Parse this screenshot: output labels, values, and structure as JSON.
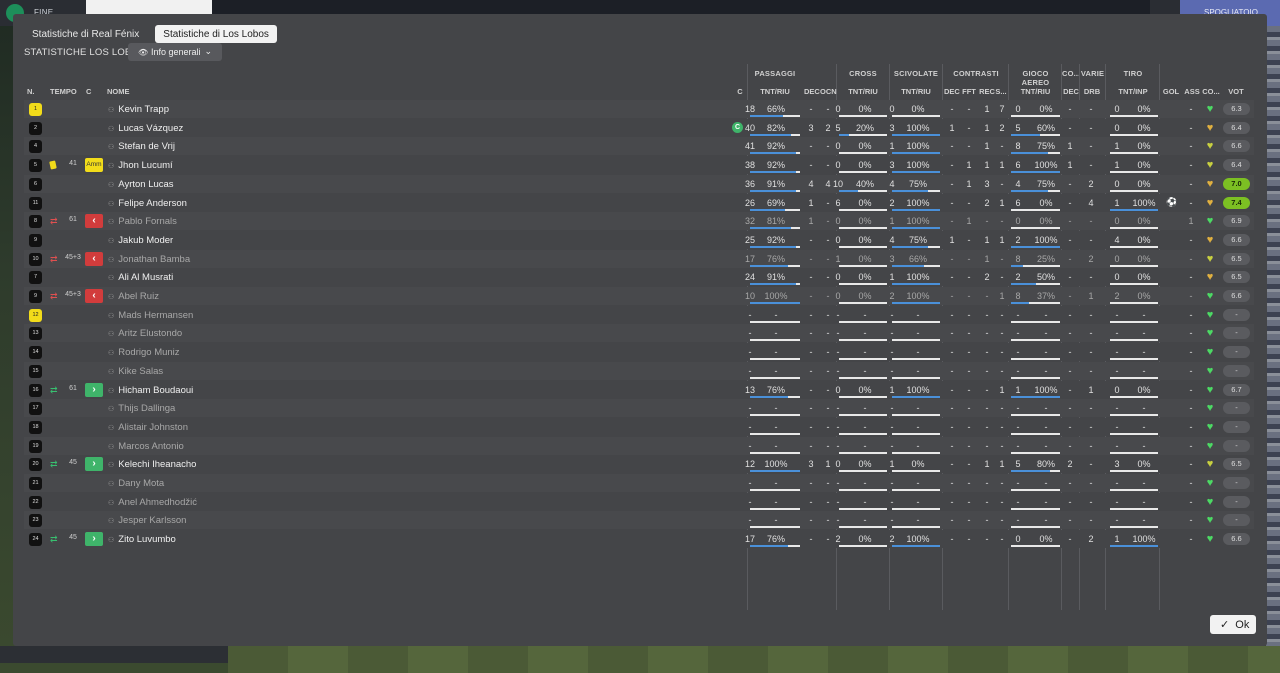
{
  "topbar": {
    "left_label": "FINE PARTITA",
    "right_label": "SPOGLIATOIO"
  },
  "tabs": [
    "Statistiche di Real Fénix",
    "Statistiche di Los Lobos"
  ],
  "subheader": "STATISTICHE LOS LOBOS",
  "dropdown": "Info generali",
  "ok_label": "Ok",
  "groups": [
    "PASSAGGI",
    "CROSS",
    "SCIVOLATE",
    "CONTRASTI",
    "GIOCO AEREO",
    "CO...",
    "VARIE",
    "TIRO"
  ],
  "columns": {
    "n": "N.",
    "tempo": "TEMPO",
    "c": "C",
    "nome": "NOME",
    "cap": "C",
    "pass_tnt": "TNT/RIU",
    "pass_dec": "DEC",
    "pass_ocn": "OCN",
    "cross_tnt": "TNT/RIU",
    "sciv_tnt": "TNT/RIU",
    "con_dec": "DEC",
    "con_fft": "FFT",
    "con_rec": "REC",
    "con_s": "S...",
    "aereo_tnt": "TNT/RIU",
    "co_dec": "DEC",
    "varie_drb": "DRB",
    "tiro_tnt": "TNT/INP",
    "gol": "GOL",
    "ass": "ASS",
    "co": "CO...",
    "vot": "VOT"
  },
  "players": [
    {
      "num": "1",
      "gk": true,
      "ev": "",
      "time": "",
      "badge": "",
      "name": "Kevin Trapp",
      "dim": false,
      "cap": false,
      "p": [
        "18",
        "66%"
      ],
      "pdec": "-",
      "pocn": "-",
      "cr": [
        "0",
        "0%"
      ],
      "sc": [
        "0",
        "0%"
      ],
      "con": [
        "-",
        "-",
        "1",
        "7"
      ],
      "ae": [
        "0",
        "0%"
      ],
      "codec": "-",
      "drb": "-",
      "ti": [
        "0",
        "0%"
      ],
      "gol": "",
      "ass": "-",
      "hc": "#4cd964",
      "vot": "6.3",
      "vg": false,
      "pf": 0.66,
      "crf": 0,
      "scf": 0,
      "aef": 0,
      "tif": 0
    },
    {
      "num": "2",
      "gk": false,
      "ev": "",
      "time": "",
      "badge": "",
      "name": "Lucas Vázquez",
      "dim": false,
      "cap": true,
      "p": [
        "40",
        "82%"
      ],
      "pdec": "3",
      "pocn": "2",
      "cr": [
        "5",
        "20%"
      ],
      "sc": [
        "3",
        "100%"
      ],
      "con": [
        "1",
        "-",
        "1",
        "2"
      ],
      "ae": [
        "5",
        "60%"
      ],
      "codec": "-",
      "drb": "-",
      "ti": [
        "0",
        "0%"
      ],
      "gol": "",
      "ass": "-",
      "hc": "#e0b040",
      "vot": "6.4",
      "vg": false,
      "pf": 0.82,
      "crf": 0.2,
      "scf": 1,
      "aef": 0.6,
      "tif": 0
    },
    {
      "num": "4",
      "gk": false,
      "ev": "",
      "time": "",
      "badge": "",
      "name": "Stefan de Vrij",
      "dim": false,
      "cap": false,
      "p": [
        "41",
        "92%"
      ],
      "pdec": "-",
      "pocn": "-",
      "cr": [
        "0",
        "0%"
      ],
      "sc": [
        "1",
        "100%"
      ],
      "con": [
        "-",
        "-",
        "1",
        "-"
      ],
      "ae": [
        "8",
        "75%"
      ],
      "codec": "1",
      "drb": "-",
      "ti": [
        "1",
        "0%"
      ],
      "gol": "",
      "ass": "-",
      "hc": "#c8d040",
      "vot": "6.6",
      "vg": false,
      "pf": 0.92,
      "crf": 0,
      "scf": 1,
      "aef": 0.75,
      "tif": 0
    },
    {
      "num": "5",
      "gk": false,
      "ev": "ycard",
      "time": "41",
      "badge": "Amm",
      "name": "Jhon Lucumí",
      "dim": false,
      "cap": false,
      "p": [
        "38",
        "92%"
      ],
      "pdec": "-",
      "pocn": "-",
      "cr": [
        "0",
        "0%"
      ],
      "sc": [
        "3",
        "100%"
      ],
      "con": [
        "-",
        "1",
        "1",
        "1"
      ],
      "ae": [
        "6",
        "100%"
      ],
      "codec": "1",
      "drb": "-",
      "ti": [
        "1",
        "0%"
      ],
      "gol": "",
      "ass": "-",
      "hc": "#c8d040",
      "vot": "6.4",
      "vg": false,
      "pf": 0.92,
      "crf": 0,
      "scf": 1,
      "aef": 1,
      "tif": 0
    },
    {
      "num": "6",
      "gk": false,
      "ev": "",
      "time": "",
      "badge": "",
      "name": "Ayrton Lucas",
      "dim": false,
      "cap": false,
      "p": [
        "36",
        "91%"
      ],
      "pdec": "4",
      "pocn": "4",
      "cr": [
        "10",
        "40%"
      ],
      "sc": [
        "4",
        "75%"
      ],
      "con": [
        "-",
        "1",
        "3",
        "-"
      ],
      "ae": [
        "4",
        "75%"
      ],
      "codec": "-",
      "drb": "2",
      "ti": [
        "0",
        "0%"
      ],
      "gol": "",
      "ass": "-",
      "hc": "#e0b040",
      "vot": "7.0",
      "vg": true,
      "pf": 0.91,
      "crf": 0.4,
      "scf": 0.75,
      "aef": 0.75,
      "tif": 0
    },
    {
      "num": "11",
      "gk": false,
      "ev": "",
      "time": "",
      "badge": "",
      "name": "Felipe Anderson",
      "dim": false,
      "cap": false,
      "p": [
        "26",
        "69%"
      ],
      "pdec": "1",
      "pocn": "-",
      "cr": [
        "6",
        "0%"
      ],
      "sc": [
        "2",
        "100%"
      ],
      "con": [
        "-",
        "-",
        "2",
        "1"
      ],
      "ae": [
        "6",
        "0%"
      ],
      "codec": "-",
      "drb": "4",
      "ti": [
        "1",
        "100%"
      ],
      "gol": "⚽",
      "ass": "-",
      "hc": "#e0b040",
      "vot": "7.4",
      "vg": true,
      "pf": 0.69,
      "crf": 0,
      "scf": 1,
      "aef": 0,
      "tif": 1
    },
    {
      "num": "8",
      "gk": false,
      "ev": "out",
      "time": "61",
      "badge": "out",
      "name": "Pablo Fornals",
      "dim": true,
      "cap": false,
      "p": [
        "32",
        "81%"
      ],
      "pdec": "1",
      "pocn": "-",
      "cr": [
        "0",
        "0%"
      ],
      "sc": [
        "1",
        "100%"
      ],
      "con": [
        "-",
        "1",
        "-",
        "-"
      ],
      "ae": [
        "0",
        "0%"
      ],
      "codec": "-",
      "drb": "-",
      "ti": [
        "0",
        "0%"
      ],
      "gol": "",
      "ass": "1",
      "hc": "#4cd964",
      "vot": "6.9",
      "vg": false,
      "pf": 0.81,
      "crf": 0,
      "scf": 1,
      "aef": 0,
      "tif": 0
    },
    {
      "num": "9",
      "gk": false,
      "ev": "",
      "time": "",
      "badge": "",
      "name": "Jakub Moder",
      "dim": false,
      "cap": false,
      "p": [
        "25",
        "92%"
      ],
      "pdec": "-",
      "pocn": "-",
      "cr": [
        "0",
        "0%"
      ],
      "sc": [
        "4",
        "75%"
      ],
      "con": [
        "1",
        "-",
        "1",
        "1"
      ],
      "ae": [
        "2",
        "100%"
      ],
      "codec": "-",
      "drb": "-",
      "ti": [
        "4",
        "0%"
      ],
      "gol": "",
      "ass": "-",
      "hc": "#e0b040",
      "vot": "6.6",
      "vg": false,
      "pf": 0.92,
      "crf": 0,
      "scf": 0.75,
      "aef": 1,
      "tif": 0
    },
    {
      "num": "10",
      "gk": false,
      "ev": "out",
      "time": "45+3",
      "badge": "out",
      "name": "Jonathan Bamba",
      "dim": true,
      "cap": false,
      "p": [
        "17",
        "76%"
      ],
      "pdec": "-",
      "pocn": "-",
      "cr": [
        "1",
        "0%"
      ],
      "sc": [
        "3",
        "66%"
      ],
      "con": [
        "-",
        "-",
        "1",
        "-"
      ],
      "ae": [
        "8",
        "25%"
      ],
      "codec": "-",
      "drb": "2",
      "ti": [
        "0",
        "0%"
      ],
      "gol": "",
      "ass": "-",
      "hc": "#c8d040",
      "vot": "6.5",
      "vg": false,
      "pf": 0.76,
      "crf": 0,
      "scf": 0.66,
      "aef": 0.25,
      "tif": 0
    },
    {
      "num": "7",
      "gk": false,
      "ev": "",
      "time": "",
      "badge": "",
      "name": "Ali Al Musrati",
      "dim": false,
      "cap": false,
      "p": [
        "24",
        "91%"
      ],
      "pdec": "-",
      "pocn": "-",
      "cr": [
        "0",
        "0%"
      ],
      "sc": [
        "1",
        "100%"
      ],
      "con": [
        "-",
        "-",
        "2",
        "-"
      ],
      "ae": [
        "2",
        "50%"
      ],
      "codec": "-",
      "drb": "-",
      "ti": [
        "0",
        "0%"
      ],
      "gol": "",
      "ass": "-",
      "hc": "#e0b040",
      "vot": "6.5",
      "vg": false,
      "pf": 0.91,
      "crf": 0,
      "scf": 1,
      "aef": 0.5,
      "tif": 0
    },
    {
      "num": "9",
      "gk": false,
      "ev": "out",
      "time": "45+3",
      "badge": "out",
      "name": "Abel Ruiz",
      "dim": true,
      "cap": false,
      "p": [
        "10",
        "100%"
      ],
      "pdec": "-",
      "pocn": "-",
      "cr": [
        "0",
        "0%"
      ],
      "sc": [
        "2",
        "100%"
      ],
      "con": [
        "-",
        "-",
        "-",
        "1"
      ],
      "ae": [
        "8",
        "37%"
      ],
      "codec": "-",
      "drb": "1",
      "ti": [
        "2",
        "0%"
      ],
      "gol": "",
      "ass": "-",
      "hc": "#4cd964",
      "vot": "6.6",
      "vg": false,
      "pf": 1,
      "crf": 0,
      "scf": 1,
      "aef": 0.37,
      "tif": 0
    },
    {
      "num": "12",
      "gk": true,
      "ev": "",
      "time": "",
      "badge": "",
      "name": "Mads Hermansen",
      "dim": true,
      "cap": false,
      "p": [
        "-",
        "-"
      ],
      "pdec": "-",
      "pocn": "-",
      "cr": [
        "-",
        "-"
      ],
      "sc": [
        "-",
        "-"
      ],
      "con": [
        "-",
        "-",
        "-",
        "-"
      ],
      "ae": [
        "-",
        "-"
      ],
      "codec": "-",
      "drb": "-",
      "ti": [
        "-",
        "-"
      ],
      "gol": "",
      "ass": "-",
      "hc": "#4cd964",
      "vot": "-",
      "vg": false,
      "pf": 0,
      "crf": 0,
      "scf": 0,
      "aef": 0,
      "tif": 0
    },
    {
      "num": "13",
      "gk": false,
      "ev": "",
      "time": "",
      "badge": "",
      "name": "Aritz Elustondo",
      "dim": true,
      "cap": false,
      "p": [
        "-",
        "-"
      ],
      "pdec": "-",
      "pocn": "-",
      "cr": [
        "-",
        "-"
      ],
      "sc": [
        "-",
        "-"
      ],
      "con": [
        "-",
        "-",
        "-",
        "-"
      ],
      "ae": [
        "-",
        "-"
      ],
      "codec": "-",
      "drb": "-",
      "ti": [
        "-",
        "-"
      ],
      "gol": "",
      "ass": "-",
      "hc": "#4cd964",
      "vot": "-",
      "vg": false,
      "pf": 0,
      "crf": 0,
      "scf": 0,
      "aef": 0,
      "tif": 0
    },
    {
      "num": "14",
      "gk": false,
      "ev": "",
      "time": "",
      "badge": "",
      "name": "Rodrigo Muniz",
      "dim": true,
      "cap": false,
      "p": [
        "-",
        "-"
      ],
      "pdec": "-",
      "pocn": "-",
      "cr": [
        "-",
        "-"
      ],
      "sc": [
        "-",
        "-"
      ],
      "con": [
        "-",
        "-",
        "-",
        "-"
      ],
      "ae": [
        "-",
        "-"
      ],
      "codec": "-",
      "drb": "-",
      "ti": [
        "-",
        "-"
      ],
      "gol": "",
      "ass": "-",
      "hc": "#4cd964",
      "vot": "-",
      "vg": false,
      "pf": 0,
      "crf": 0,
      "scf": 0,
      "aef": 0,
      "tif": 0
    },
    {
      "num": "15",
      "gk": false,
      "ev": "",
      "time": "",
      "badge": "",
      "name": "Kike Salas",
      "dim": true,
      "cap": false,
      "p": [
        "-",
        "-"
      ],
      "pdec": "-",
      "pocn": "-",
      "cr": [
        "-",
        "-"
      ],
      "sc": [
        "-",
        "-"
      ],
      "con": [
        "-",
        "-",
        "-",
        "-"
      ],
      "ae": [
        "-",
        "-"
      ],
      "codec": "-",
      "drb": "-",
      "ti": [
        "-",
        "-"
      ],
      "gol": "",
      "ass": "-",
      "hc": "#4cd964",
      "vot": "-",
      "vg": false,
      "pf": 0,
      "crf": 0,
      "scf": 0,
      "aef": 0,
      "tif": 0
    },
    {
      "num": "16",
      "gk": false,
      "ev": "in",
      "time": "61",
      "badge": "in",
      "name": "Hicham Boudaoui",
      "dim": false,
      "cap": false,
      "p": [
        "13",
        "76%"
      ],
      "pdec": "-",
      "pocn": "-",
      "cr": [
        "0",
        "0%"
      ],
      "sc": [
        "1",
        "100%"
      ],
      "con": [
        "-",
        "-",
        "-",
        "1"
      ],
      "ae": [
        "1",
        "100%"
      ],
      "codec": "-",
      "drb": "1",
      "ti": [
        "0",
        "0%"
      ],
      "gol": "",
      "ass": "-",
      "hc": "#4cd964",
      "vot": "6.7",
      "vg": false,
      "pf": 0.76,
      "crf": 0,
      "scf": 1,
      "aef": 1,
      "tif": 0
    },
    {
      "num": "17",
      "gk": false,
      "ev": "",
      "time": "",
      "badge": "",
      "name": "Thijs Dallinga",
      "dim": true,
      "cap": false,
      "p": [
        "-",
        "-"
      ],
      "pdec": "-",
      "pocn": "-",
      "cr": [
        "-",
        "-"
      ],
      "sc": [
        "-",
        "-"
      ],
      "con": [
        "-",
        "-",
        "-",
        "-"
      ],
      "ae": [
        "-",
        "-"
      ],
      "codec": "-",
      "drb": "-",
      "ti": [
        "-",
        "-"
      ],
      "gol": "",
      "ass": "-",
      "hc": "#4cd964",
      "vot": "-",
      "vg": false,
      "pf": 0,
      "crf": 0,
      "scf": 0,
      "aef": 0,
      "tif": 0
    },
    {
      "num": "18",
      "gk": false,
      "ev": "",
      "time": "",
      "badge": "",
      "name": "Alistair Johnston",
      "dim": true,
      "cap": false,
      "p": [
        "-",
        "-"
      ],
      "pdec": "-",
      "pocn": "-",
      "cr": [
        "-",
        "-"
      ],
      "sc": [
        "-",
        "-"
      ],
      "con": [
        "-",
        "-",
        "-",
        "-"
      ],
      "ae": [
        "-",
        "-"
      ],
      "codec": "-",
      "drb": "-",
      "ti": [
        "-",
        "-"
      ],
      "gol": "",
      "ass": "-",
      "hc": "#4cd964",
      "vot": "-",
      "vg": false,
      "pf": 0,
      "crf": 0,
      "scf": 0,
      "aef": 0,
      "tif": 0
    },
    {
      "num": "19",
      "gk": false,
      "ev": "",
      "time": "",
      "badge": "",
      "name": "Marcos Antonio",
      "dim": true,
      "cap": false,
      "p": [
        "-",
        "-"
      ],
      "pdec": "-",
      "pocn": "-",
      "cr": [
        "-",
        "-"
      ],
      "sc": [
        "-",
        "-"
      ],
      "con": [
        "-",
        "-",
        "-",
        "-"
      ],
      "ae": [
        "-",
        "-"
      ],
      "codec": "-",
      "drb": "-",
      "ti": [
        "-",
        "-"
      ],
      "gol": "",
      "ass": "-",
      "hc": "#4cd964",
      "vot": "-",
      "vg": false,
      "pf": 0,
      "crf": 0,
      "scf": 0,
      "aef": 0,
      "tif": 0
    },
    {
      "num": "20",
      "gk": false,
      "ev": "in",
      "time": "45",
      "badge": "in",
      "name": "Kelechi Iheanacho",
      "dim": false,
      "cap": false,
      "p": [
        "12",
        "100%"
      ],
      "pdec": "3",
      "pocn": "1",
      "cr": [
        "0",
        "0%"
      ],
      "sc": [
        "1",
        "0%"
      ],
      "con": [
        "-",
        "-",
        "1",
        "1"
      ],
      "ae": [
        "5",
        "80%"
      ],
      "codec": "2",
      "drb": "-",
      "ti": [
        "3",
        "0%"
      ],
      "gol": "",
      "ass": "-",
      "hc": "#c8d040",
      "vot": "6.5",
      "vg": false,
      "pf": 1,
      "crf": 0,
      "scf": 0,
      "aef": 0.8,
      "tif": 0
    },
    {
      "num": "21",
      "gk": false,
      "ev": "",
      "time": "",
      "badge": "",
      "name": "Dany Mota",
      "dim": true,
      "cap": false,
      "p": [
        "-",
        "-"
      ],
      "pdec": "-",
      "pocn": "-",
      "cr": [
        "-",
        "-"
      ],
      "sc": [
        "-",
        "-"
      ],
      "con": [
        "-",
        "-",
        "-",
        "-"
      ],
      "ae": [
        "-",
        "-"
      ],
      "codec": "-",
      "drb": "-",
      "ti": [
        "-",
        "-"
      ],
      "gol": "",
      "ass": "-",
      "hc": "#4cd964",
      "vot": "-",
      "vg": false,
      "pf": 0,
      "crf": 0,
      "scf": 0,
      "aef": 0,
      "tif": 0
    },
    {
      "num": "22",
      "gk": false,
      "ev": "",
      "time": "",
      "badge": "",
      "name": "Anel Ahmedhodžić",
      "dim": true,
      "cap": false,
      "p": [
        "-",
        "-"
      ],
      "pdec": "-",
      "pocn": "-",
      "cr": [
        "-",
        "-"
      ],
      "sc": [
        "-",
        "-"
      ],
      "con": [
        "-",
        "-",
        "-",
        "-"
      ],
      "ae": [
        "-",
        "-"
      ],
      "codec": "-",
      "drb": "-",
      "ti": [
        "-",
        "-"
      ],
      "gol": "",
      "ass": "-",
      "hc": "#4cd964",
      "vot": "-",
      "vg": false,
      "pf": 0,
      "crf": 0,
      "scf": 0,
      "aef": 0,
      "tif": 0
    },
    {
      "num": "23",
      "gk": false,
      "ev": "",
      "time": "",
      "badge": "",
      "name": "Jesper Karlsson",
      "dim": true,
      "cap": false,
      "p": [
        "-",
        "-"
      ],
      "pdec": "-",
      "pocn": "-",
      "cr": [
        "-",
        "-"
      ],
      "sc": [
        "-",
        "-"
      ],
      "con": [
        "-",
        "-",
        "-",
        "-"
      ],
      "ae": [
        "-",
        "-"
      ],
      "codec": "-",
      "drb": "-",
      "ti": [
        "-",
        "-"
      ],
      "gol": "",
      "ass": "-",
      "hc": "#4cd964",
      "vot": "-",
      "vg": false,
      "pf": 0,
      "crf": 0,
      "scf": 0,
      "aef": 0,
      "tif": 0
    },
    {
      "num": "24",
      "gk": false,
      "ev": "in",
      "time": "45",
      "badge": "in",
      "name": "Zito Luvumbo",
      "dim": false,
      "cap": false,
      "p": [
        "17",
        "76%"
      ],
      "pdec": "-",
      "pocn": "-",
      "cr": [
        "2",
        "0%"
      ],
      "sc": [
        "2",
        "100%"
      ],
      "con": [
        "-",
        "-",
        "-",
        "-"
      ],
      "ae": [
        "0",
        "0%"
      ],
      "codec": "-",
      "drb": "2",
      "ti": [
        "1",
        "100%"
      ],
      "gol": "",
      "ass": "-",
      "hc": "#4cd964",
      "vot": "6.6",
      "vg": false,
      "pf": 0.76,
      "crf": 0,
      "scf": 1,
      "aef": 0,
      "tif": 1
    }
  ]
}
